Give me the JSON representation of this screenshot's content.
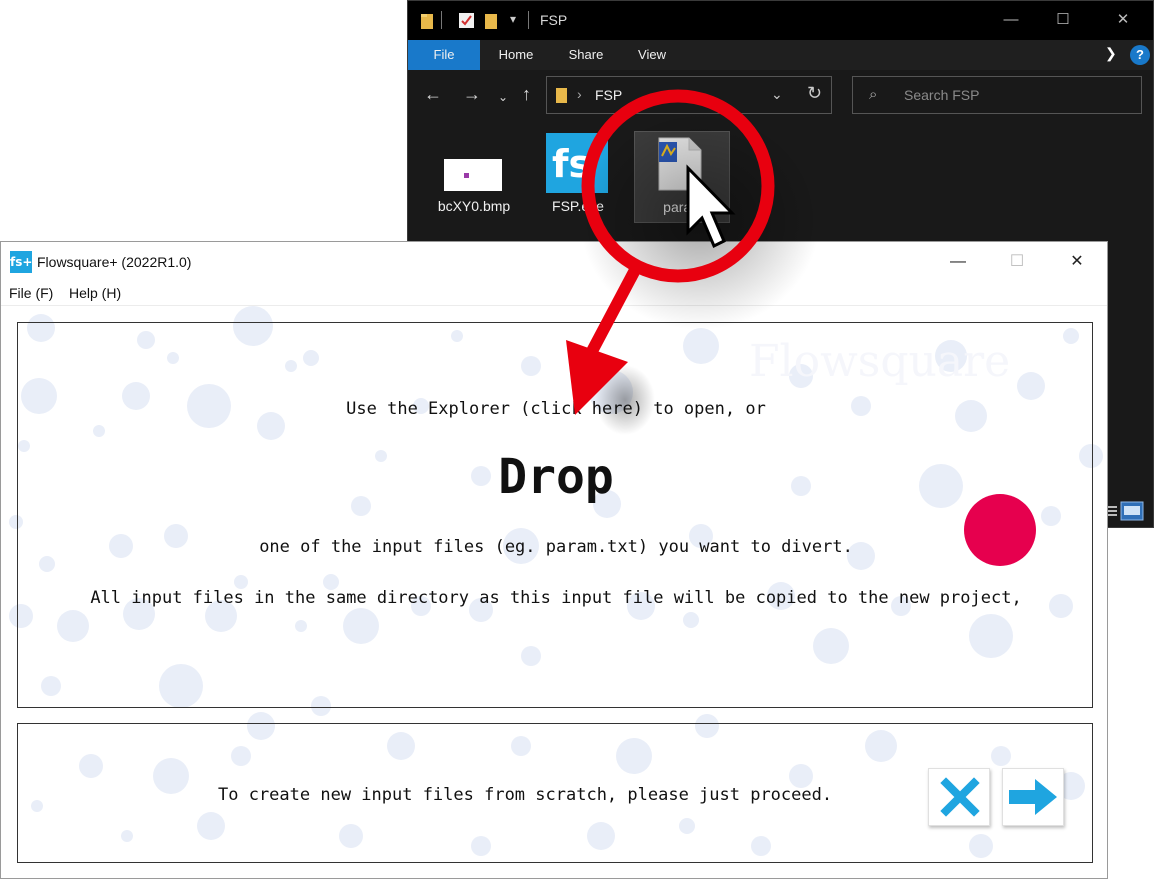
{
  "explorer": {
    "title": "FSP",
    "window_controls": {
      "minimize": "—",
      "maximize": "☐",
      "close": "✕"
    },
    "ribbon": {
      "file": "File",
      "home": "Home",
      "share": "Share",
      "view": "View",
      "help": "?"
    },
    "address": {
      "path": "FSP"
    },
    "search": {
      "placeholder": "Search FSP"
    },
    "files": [
      {
        "name": "bcXY0.bmp",
        "icon": "bitmap-icon"
      },
      {
        "name": "FSP.exe",
        "icon": "fs-app-icon"
      },
      {
        "name": "param",
        "icon": "text-file-icon"
      }
    ]
  },
  "flowsquare": {
    "title": "Flowsquare+ (2022R1.0)",
    "logo_text": "fs+",
    "window_controls": {
      "minimize": "—",
      "maximize": "☐",
      "close": "✕"
    },
    "menu": {
      "file": "File (F)",
      "help": "Help (H)"
    },
    "drop_panel": {
      "line1": "Use the Explorer (click here) to open, or",
      "headline": "Drop",
      "line2": "one of the input files (eg. param.txt) you want to divert.",
      "line3": "All input files in the same directory as this input file will be copied to the new project,"
    },
    "proceed_panel": {
      "text": "To create new input files from scratch, please just proceed."
    },
    "watermark": "Flowsquare",
    "colors": {
      "accent": "#1fa5e0",
      "status_dot": "#e6004e",
      "callout": "#e8000f"
    }
  }
}
